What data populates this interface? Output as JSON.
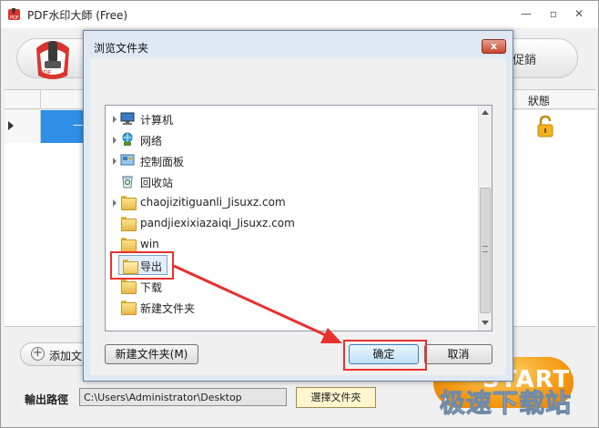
{
  "app": {
    "title": "PDF水印大師 (Free)",
    "toolbar_text": "促銷",
    "grid": {
      "status_header": "狀態",
      "row_dash": "—"
    },
    "add_button_label": "添加文",
    "output": {
      "label": "輸出路徑",
      "path": "C:\\Users\\Administrator\\Desktop",
      "select_button": "選擇文件夾"
    },
    "start_label": "START"
  },
  "dialog": {
    "title": "浏览文件夹",
    "close_glyph": "x",
    "tree": [
      {
        "label": "计算机",
        "icon": "computer-icon",
        "expander": true
      },
      {
        "label": "网络",
        "icon": "network-icon",
        "expander": true
      },
      {
        "label": "控制面板",
        "icon": "control-panel-icon",
        "expander": true
      },
      {
        "label": "回收站",
        "icon": "recycle-bin-icon",
        "expander": false
      },
      {
        "label": "chaojizitiguanli_Jisuxz.com",
        "icon": "folder-icon",
        "expander": true
      },
      {
        "label": "pandjiexixiazaiqi_Jisuxz.com",
        "icon": "folder-icon",
        "expander": false
      },
      {
        "label": "win",
        "icon": "folder-icon",
        "expander": false
      },
      {
        "label": "导出",
        "icon": "folder-icon",
        "expander": false,
        "selected": true
      },
      {
        "label": "下载",
        "icon": "folder-icon",
        "expander": false
      },
      {
        "label": "新建文件夹",
        "icon": "folder-icon",
        "expander": false
      }
    ],
    "buttons": {
      "new_folder": "新建文件夹(M)",
      "ok": "确定",
      "cancel": "取消"
    }
  },
  "watermark": "极速下载站",
  "colors": {
    "highlight": "#e8312f",
    "selection": "#2f8ee6",
    "start": "#f59a14"
  }
}
